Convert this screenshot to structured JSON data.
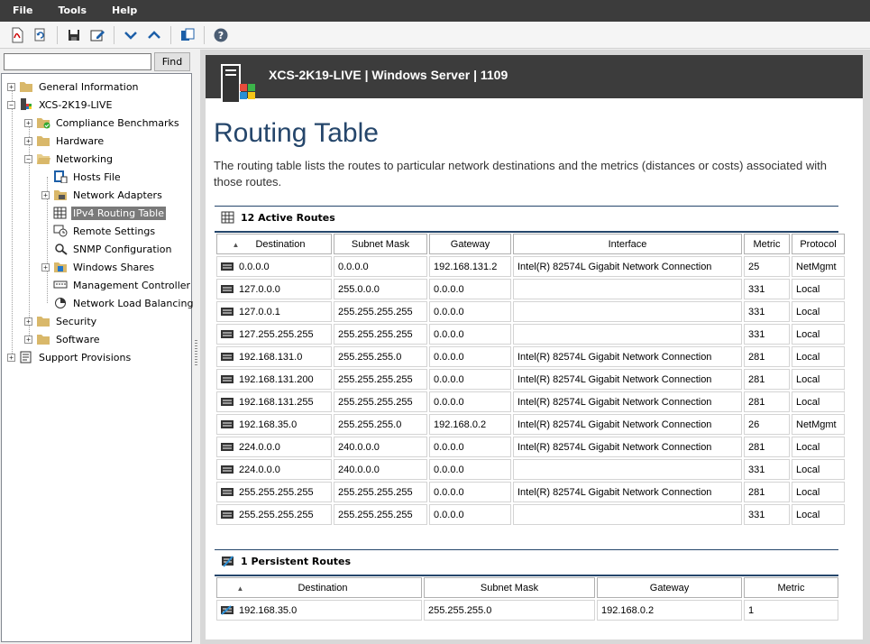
{
  "menu": [
    "File",
    "Tools",
    "Help"
  ],
  "toolbar": {
    "icons": [
      "pdf-export-icon",
      "refresh-icon",
      "save-icon",
      "edit-icon",
      "collapse-down-icon",
      "expand-up-icon",
      "copy-icon",
      "help-icon"
    ]
  },
  "search": {
    "value": "",
    "find_label": "Find"
  },
  "tree": {
    "general_information": "General Information",
    "host": "XCS-2K19-LIVE",
    "compliance_benchmarks": "Compliance Benchmarks",
    "hardware": "Hardware",
    "networking": "Networking",
    "hosts_file": "Hosts File",
    "network_adapters": "Network Adapters",
    "ipv4_routing_table": "IPv4 Routing Table",
    "remote_settings": "Remote Settings",
    "snmp_configuration": "SNMP Configuration",
    "windows_shares": "Windows Shares",
    "management_controller": "Management Controller",
    "network_load_balancing": "Network Load Balancing",
    "security": "Security",
    "software": "Software",
    "support_provisions": "Support Provisions"
  },
  "header": {
    "title": "XCS-2K19-LIVE | Windows Server | 1109"
  },
  "page": {
    "title": "Routing Table",
    "description": "The routing table lists the routes to particular network destinations and the metrics (distances or costs) associated with those routes."
  },
  "active_routes": {
    "title": "12 Active Routes",
    "columns": [
      "Destination",
      "Subnet Mask",
      "Gateway",
      "Interface",
      "Metric",
      "Protocol"
    ],
    "rows": [
      [
        "0.0.0.0",
        "0.0.0.0",
        "192.168.131.2",
        "Intel(R) 82574L Gigabit Network Connection",
        "25",
        "NetMgmt"
      ],
      [
        "127.0.0.0",
        "255.0.0.0",
        "0.0.0.0",
        "",
        "331",
        "Local"
      ],
      [
        "127.0.0.1",
        "255.255.255.255",
        "0.0.0.0",
        "",
        "331",
        "Local"
      ],
      [
        "127.255.255.255",
        "255.255.255.255",
        "0.0.0.0",
        "",
        "331",
        "Local"
      ],
      [
        "192.168.131.0",
        "255.255.255.0",
        "0.0.0.0",
        "Intel(R) 82574L Gigabit Network Connection",
        "281",
        "Local"
      ],
      [
        "192.168.131.200",
        "255.255.255.255",
        "0.0.0.0",
        "Intel(R) 82574L Gigabit Network Connection",
        "281",
        "Local"
      ],
      [
        "192.168.131.255",
        "255.255.255.255",
        "0.0.0.0",
        "Intel(R) 82574L Gigabit Network Connection",
        "281",
        "Local"
      ],
      [
        "192.168.35.0",
        "255.255.255.0",
        "192.168.0.2",
        "Intel(R) 82574L Gigabit Network Connection",
        "26",
        "NetMgmt"
      ],
      [
        "224.0.0.0",
        "240.0.0.0",
        "0.0.0.0",
        "Intel(R) 82574L Gigabit Network Connection",
        "281",
        "Local"
      ],
      [
        "224.0.0.0",
        "240.0.0.0",
        "0.0.0.0",
        "",
        "331",
        "Local"
      ],
      [
        "255.255.255.255",
        "255.255.255.255",
        "0.0.0.0",
        "Intel(R) 82574L Gigabit Network Connection",
        "281",
        "Local"
      ],
      [
        "255.255.255.255",
        "255.255.255.255",
        "0.0.0.0",
        "",
        "331",
        "Local"
      ]
    ]
  },
  "persistent_routes": {
    "title": "1 Persistent Routes",
    "columns": [
      "Destination",
      "Subnet Mask",
      "Gateway",
      "Metric"
    ],
    "rows": [
      [
        "192.168.35.0",
        "255.255.255.0",
        "192.168.0.2",
        "1"
      ]
    ]
  },
  "colors": {
    "accent": "#25466b",
    "header_bg": "#3c3c3c",
    "selected_bg": "#7a7a7a"
  }
}
